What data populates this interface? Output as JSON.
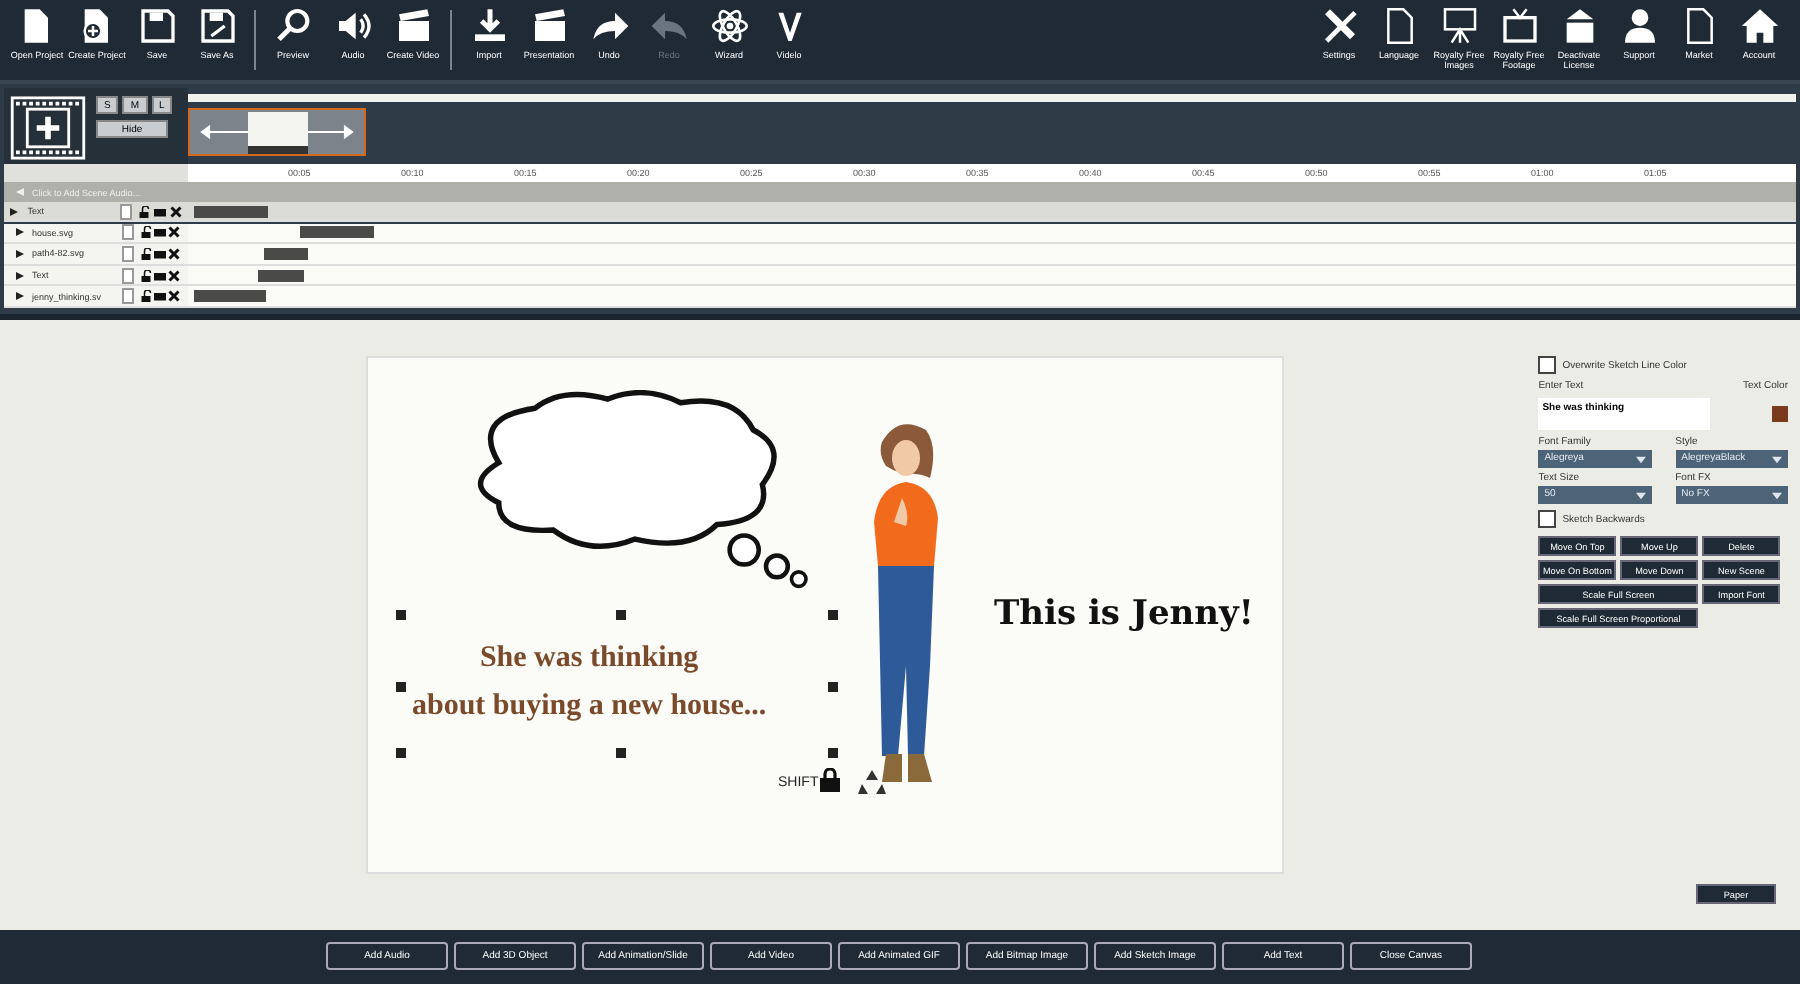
{
  "toolbar": {
    "left_groups": [
      [
        {
          "label": "Open Project",
          "disabled": false
        },
        {
          "label": "Create Project",
          "disabled": false
        },
        {
          "label": "Save",
          "disabled": false
        },
        {
          "label": "Save As",
          "disabled": false
        }
      ],
      [
        {
          "label": "Preview",
          "disabled": false
        },
        {
          "label": "Audio",
          "disabled": false
        },
        {
          "label": "Create Video",
          "disabled": false
        }
      ],
      [
        {
          "label": "Import",
          "disabled": false
        },
        {
          "label": "Presentation",
          "disabled": false
        },
        {
          "label": "Undo",
          "disabled": false
        },
        {
          "label": "Redo",
          "disabled": true
        },
        {
          "label": "Wizard",
          "disabled": false
        },
        {
          "label": "Videlo",
          "disabled": false
        }
      ]
    ],
    "right": [
      {
        "label": "Settings"
      },
      {
        "label": "Language"
      },
      {
        "label": "Royalty Free Images"
      },
      {
        "label": "Royalty Free Footage"
      },
      {
        "label": "Deactivate License"
      },
      {
        "label": "Support"
      },
      {
        "label": "Market"
      },
      {
        "label": "Account"
      }
    ]
  },
  "timeline": {
    "size_buttons": [
      {
        "label": "S"
      },
      {
        "label": "M"
      },
      {
        "label": "L"
      }
    ],
    "hide_button": "Hide",
    "ruler": [
      "00:05",
      "00:10",
      "00:15",
      "00:20",
      "00:25",
      "00:30",
      "00:35",
      "00:40",
      "00:45",
      "00:50",
      "00:55",
      "01:00",
      "01:05"
    ],
    "audio_row": "Click to Add Scene Audio...",
    "tracks": [
      {
        "name": "Text",
        "selected": true
      },
      {
        "name": "house.svg",
        "selected": false
      },
      {
        "name": "path4-82.svg",
        "selected": false
      },
      {
        "name": "Text",
        "selected": false
      },
      {
        "name": "jenny_thinking.sv",
        "selected": false
      }
    ]
  },
  "canvas": {
    "text": [
      "She was thinking",
      "about buying a new house..."
    ],
    "shift_label": "SHIFT",
    "title": "This is Jenny!"
  },
  "properties": {
    "overwrite_line_color": {
      "label": "Overwrite Sketch Line Color",
      "checked": false
    },
    "enter_text_label": "Enter Text",
    "text_color": {
      "label": "Text Color",
      "color": "#7a3a1c"
    },
    "text_value": "She was thinking",
    "selects": [
      {
        "label": "Font Family",
        "value": "Alegreya"
      },
      {
        "label": "Style",
        "value": "AlegreyaBlack"
      },
      {
        "label": "Text Size",
        "value": "50"
      },
      {
        "label": "Font FX",
        "value": "No FX"
      }
    ],
    "sketch_backwards": {
      "label": "Sketch Backwards",
      "checked": false
    },
    "buttons": [
      "Move On Top",
      "Move Up",
      "Delete",
      "Move On Bottom",
      "Move Down",
      "New Scene"
    ],
    "wide_buttons": [
      "Scale Full Screen",
      "Import Font",
      "Scale Full Screen Proportional"
    ]
  },
  "paper_button": "Paper",
  "bottom_buttons": [
    "Add Audio",
    "Add 3D Object",
    "Add Animation/Slide",
    "Add Video",
    "Add Animated GIF",
    "Add Bitmap Image",
    "Add Sketch Image",
    "Add Text",
    "Close Canvas"
  ]
}
